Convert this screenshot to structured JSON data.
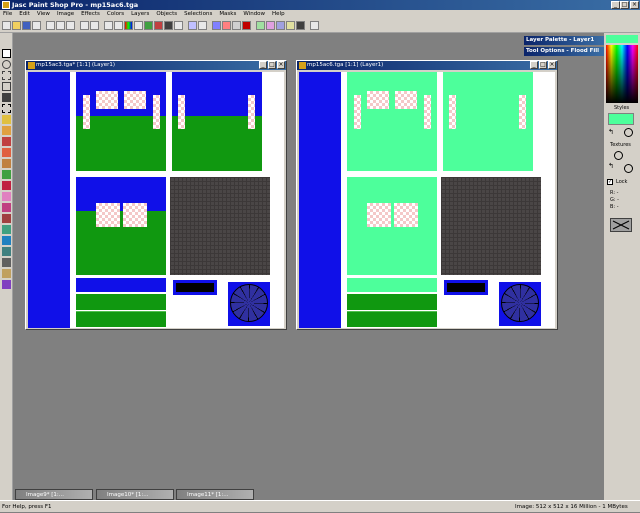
{
  "window": {
    "title": "Jasc Paint Shop Pro - mp15ac6.tga"
  },
  "menu": [
    "File",
    "Edit",
    "View",
    "Image",
    "Effects",
    "Colors",
    "Layers",
    "Objects",
    "Selections",
    "Masks",
    "Window",
    "Help"
  ],
  "doc1": {
    "title": "mp15ac3.tga* [1:1] (Layer1)"
  },
  "doc2": {
    "title": "mp15ac6.tga [1:1] (Layer1)"
  },
  "palettes": {
    "layer": "Layer Palette - Layer1",
    "tool_options": "Tool Options - Flood Fill"
  },
  "right": {
    "styles": "Styles",
    "textures": "Textures",
    "lock": "Lock",
    "r": "R:",
    "g": "G:",
    "b": "B:",
    "dash": "-",
    "fg_color": "#4dff9b"
  },
  "minimized": [
    "Image9* [1:...",
    "Image10* [1:...",
    "Image11* [1:..."
  ],
  "status": {
    "left": "For Help, press F1",
    "right": "Image:  512 x 512 x 16 Million - 1 MBytes"
  }
}
